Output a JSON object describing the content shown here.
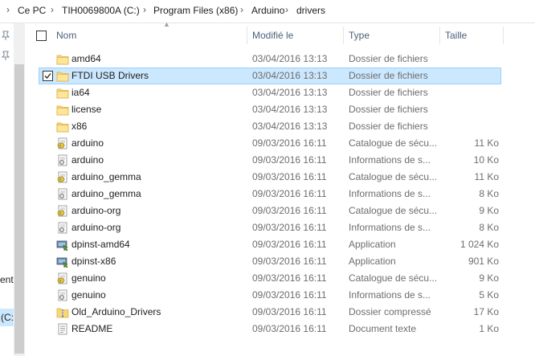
{
  "breadcrumb": [
    "Ce PC",
    "TIH0069800A (C:)",
    "Program Files (x86)",
    "Arduino",
    "drivers"
  ],
  "nav": {
    "partial_label_1": "ent",
    "partial_label_2": "(C:"
  },
  "columns": {
    "name": "Nom",
    "modified": "Modifié le",
    "type": "Type",
    "size": "Taille"
  },
  "rows": [
    {
      "name": "amd64",
      "date": "03/04/2016 13:13",
      "type": "Dossier de fichiers",
      "size": "",
      "icon": "folder-icon"
    },
    {
      "name": "FTDI USB Drivers",
      "date": "03/04/2016 13:13",
      "type": "Dossier de fichiers",
      "size": "",
      "icon": "folder-icon",
      "selected": true
    },
    {
      "name": "ia64",
      "date": "03/04/2016 13:13",
      "type": "Dossier de fichiers",
      "size": "",
      "icon": "folder-icon"
    },
    {
      "name": "license",
      "date": "03/04/2016 13:13",
      "type": "Dossier de fichiers",
      "size": "",
      "icon": "folder-icon"
    },
    {
      "name": "x86",
      "date": "03/04/2016 13:13",
      "type": "Dossier de fichiers",
      "size": "",
      "icon": "folder-icon"
    },
    {
      "name": "arduino",
      "date": "09/03/2016 16:11",
      "type": "Catalogue de sécu...",
      "size": "11 Ko",
      "icon": "security-catalog-icon"
    },
    {
      "name": "arduino",
      "date": "09/03/2016 16:11",
      "type": "Informations de s...",
      "size": "10 Ko",
      "icon": "setup-info-icon"
    },
    {
      "name": "arduino_gemma",
      "date": "09/03/2016 16:11",
      "type": "Catalogue de sécu...",
      "size": "11 Ko",
      "icon": "security-catalog-icon"
    },
    {
      "name": "arduino_gemma",
      "date": "09/03/2016 16:11",
      "type": "Informations de s...",
      "size": "8 Ko",
      "icon": "setup-info-icon"
    },
    {
      "name": "arduino-org",
      "date": "09/03/2016 16:11",
      "type": "Catalogue de sécu...",
      "size": "9 Ko",
      "icon": "security-catalog-icon"
    },
    {
      "name": "arduino-org",
      "date": "09/03/2016 16:11",
      "type": "Informations de s...",
      "size": "8 Ko",
      "icon": "setup-info-icon"
    },
    {
      "name": "dpinst-amd64",
      "date": "09/03/2016 16:11",
      "type": "Application",
      "size": "1 024 Ko",
      "icon": "application-icon"
    },
    {
      "name": "dpinst-x86",
      "date": "09/03/2016 16:11",
      "type": "Application",
      "size": "901 Ko",
      "icon": "application-icon"
    },
    {
      "name": "genuino",
      "date": "09/03/2016 16:11",
      "type": "Catalogue de sécu...",
      "size": "9 Ko",
      "icon": "security-catalog-icon"
    },
    {
      "name": "genuino",
      "date": "09/03/2016 16:11",
      "type": "Informations de s...",
      "size": "5 Ko",
      "icon": "setup-info-icon"
    },
    {
      "name": "Old_Arduino_Drivers",
      "date": "09/03/2016 16:11",
      "type": "Dossier compressé",
      "size": "17 Ko",
      "icon": "zip-folder-icon"
    },
    {
      "name": "README",
      "date": "09/03/2016 16:11",
      "type": "Document texte",
      "size": "1 Ko",
      "icon": "text-document-icon"
    }
  ]
}
